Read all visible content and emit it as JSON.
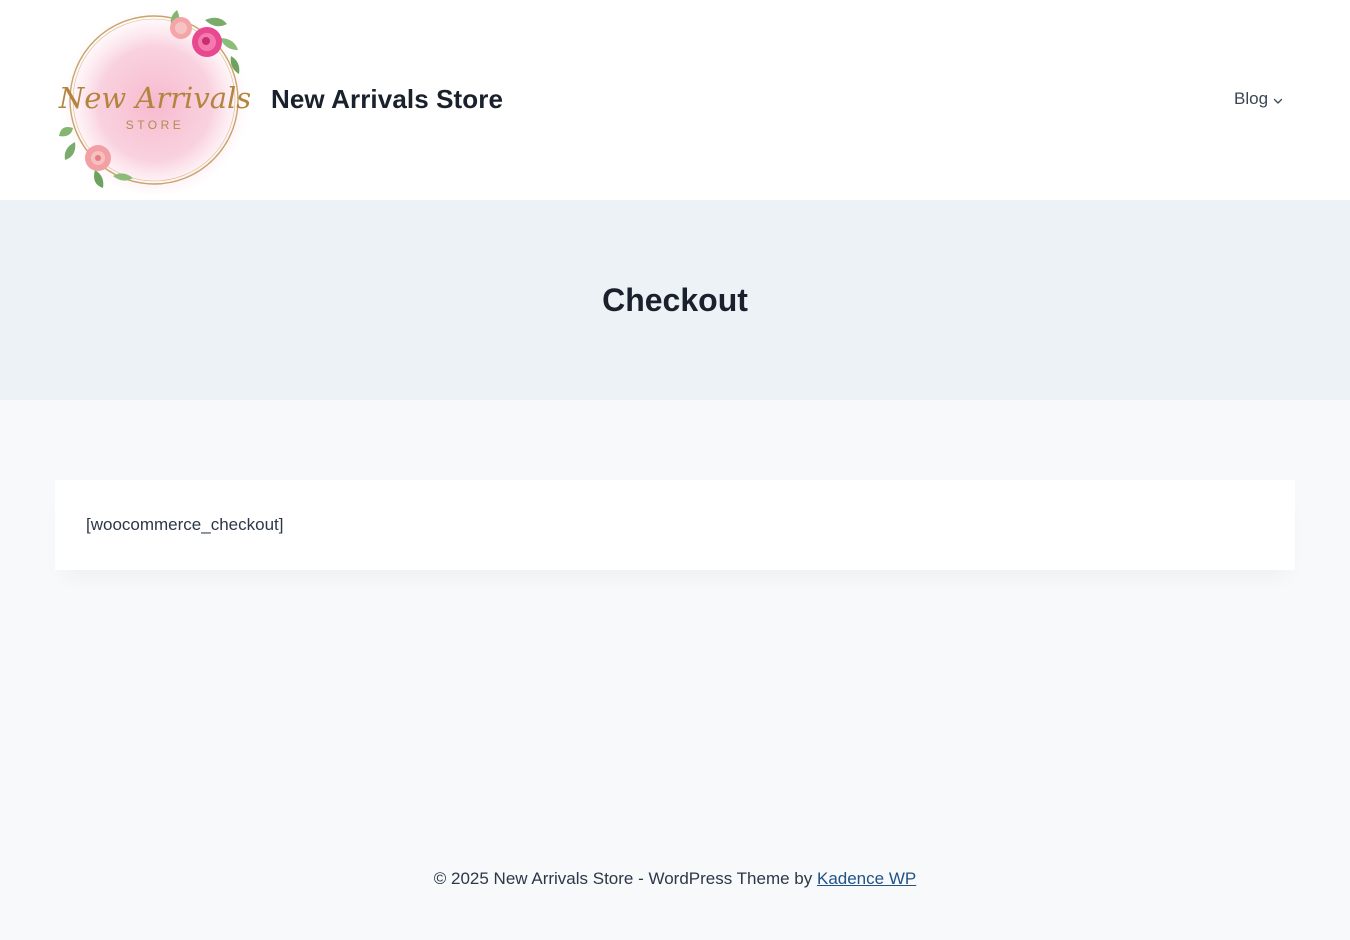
{
  "header": {
    "logo": {
      "line1": "New Arrivals",
      "line2": "STORE",
      "icon": "floral-wreath-logo"
    },
    "site_title": "New Arrivals Store",
    "nav": {
      "items": [
        {
          "label": "Blog",
          "has_submenu": true,
          "icon": "chevron-down-icon"
        }
      ]
    }
  },
  "page": {
    "title": "Checkout",
    "content_text": "[woocommerce_checkout]"
  },
  "footer": {
    "copyright": "© 2025 New Arrivals Store - WordPress Theme by ",
    "link_label": "Kadence WP"
  },
  "colors": {
    "header_bg": "#ffffff",
    "title_band_bg": "#edf2f7",
    "page_bg": "#f7f9fb",
    "heading": "#1a202c",
    "body_text": "#2d3748",
    "link": "#215387",
    "logo_pink": "#f7bfd2",
    "logo_gold": "#c9a46a"
  }
}
